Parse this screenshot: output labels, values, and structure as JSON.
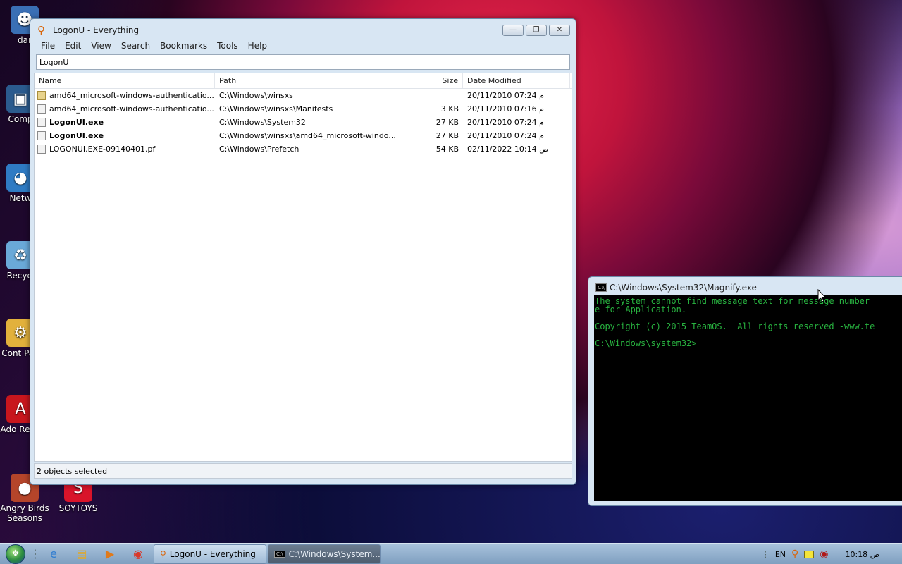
{
  "desktop": {
    "icons": [
      {
        "label": "dar",
        "glyph": "user-icon"
      },
      {
        "label": "Comp",
        "glyph": "computer-icon"
      },
      {
        "label": "Netw",
        "glyph": "network-icon"
      },
      {
        "label": "Recycl",
        "glyph": "recycle-bin-icon"
      },
      {
        "label": "Cont Pan",
        "glyph": "control-panel-icon"
      },
      {
        "label": "Ado Read",
        "glyph": "adobe-reader-icon"
      },
      {
        "label": "Angry Birds Seasons",
        "glyph": "angry-birds-icon"
      },
      {
        "label": "SOYTOYS",
        "glyph": "soytoys-icon"
      }
    ]
  },
  "everything": {
    "title": "LogonU - Everything",
    "menu": [
      "File",
      "Edit",
      "View",
      "Search",
      "Bookmarks",
      "Tools",
      "Help"
    ],
    "search_value": "LogonU",
    "columns": {
      "name": "Name",
      "path": "Path",
      "size": "Size",
      "date": "Date Modified"
    },
    "rows": [
      {
        "name": "amd64_microsoft-windows-authenticatio...",
        "path": "C:\\Windows\\winsxs",
        "size": "",
        "date": "20/11/2010 07:24 م",
        "type": "folder",
        "selected": false
      },
      {
        "name": "amd64_microsoft-windows-authenticatio...",
        "path": "C:\\Windows\\winsxs\\Manifests",
        "size": "3 KB",
        "date": "20/11/2010 07:16 م",
        "type": "file",
        "selected": false
      },
      {
        "name": "LogonUI.exe",
        "path": "C:\\Windows\\System32",
        "size": "27 KB",
        "date": "20/11/2010 07:24 م",
        "type": "exe",
        "selected": true
      },
      {
        "name": "LogonUI.exe",
        "path": "C:\\Windows\\winsxs\\amd64_microsoft-windo...",
        "size": "27 KB",
        "date": "20/11/2010 07:24 م",
        "type": "exe",
        "selected": true
      },
      {
        "name": "LOGONUI.EXE-09140401.pf",
        "path": "C:\\Windows\\Prefetch",
        "size": "54 KB",
        "date": "02/11/2022 10:14 ص",
        "type": "file",
        "selected": false
      }
    ],
    "status": "2 objects selected"
  },
  "cmd": {
    "title": "C:\\Windows\\System32\\Magnify.exe",
    "lines": [
      "The system cannot find message text for message number",
      "e for Application.",
      "",
      "Copyright (c) 2015 TeamOS.  All rights reserved -www.te",
      "",
      "C:\\Windows\\system32>"
    ]
  },
  "taskbar": {
    "tasks": [
      {
        "label": "LogonU - Everything",
        "active": false
      },
      {
        "label": "C:\\Windows\\System...",
        "active": true
      }
    ],
    "lang": "EN",
    "clock": "10:18 ص"
  }
}
